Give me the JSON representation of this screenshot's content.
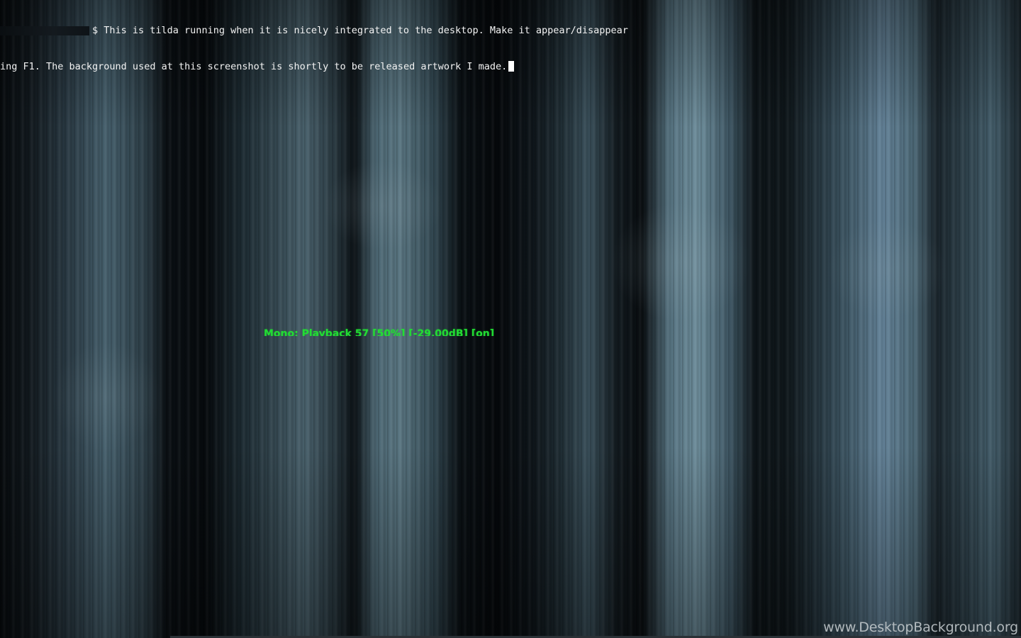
{
  "terminal": {
    "app": "tilda",
    "lines": [
      {
        "prompt_symbol": "$",
        "text": " This is tilda running when it is nicely integrated to the desktop. Make it appear/disappear"
      },
      {
        "text": "ing F1. The background used at this screenshot is shortly to be released artwork I made."
      }
    ]
  },
  "volume_osd": {
    "text": "Mono: Playback 57 [50%] [-29.00dB] [on]"
  },
  "watermark": {
    "text": "www.DesktopBackground.org"
  },
  "colors": {
    "terminal_text": "#f2f2f2",
    "osd_text": "#22dd33",
    "watermark_text": "#c9cfd2"
  }
}
